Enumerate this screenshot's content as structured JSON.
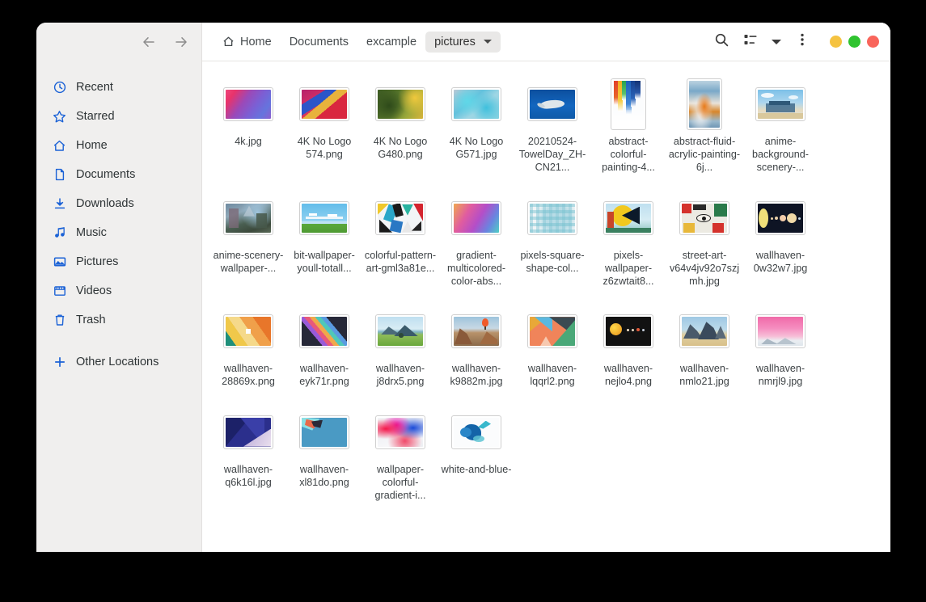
{
  "window": {
    "background_color": "#000000",
    "body_color": "#ffffff",
    "sidebar_color": "#f0efee"
  },
  "sidebar": {
    "nav": {
      "back_label": "Back",
      "back_icon": "arrow-left-icon",
      "forward_label": "Forward",
      "forward_icon": "arrow-right-icon"
    },
    "items": [
      {
        "label": "Recent",
        "icon": "clock-icon"
      },
      {
        "label": "Starred",
        "icon": "star-icon"
      },
      {
        "label": "Home",
        "icon": "home-icon"
      },
      {
        "label": "Documents",
        "icon": "document-icon"
      },
      {
        "label": "Downloads",
        "icon": "download-icon"
      },
      {
        "label": "Music",
        "icon": "music-note-icon"
      },
      {
        "label": "Pictures",
        "icon": "picture-icon"
      },
      {
        "label": "Videos",
        "icon": "video-icon"
      },
      {
        "label": "Trash",
        "icon": "trash-icon"
      },
      {
        "label": "Other Locations",
        "icon": "plus-icon"
      }
    ],
    "accent_color": "#1b62d6"
  },
  "toolbar": {
    "breadcrumb": [
      {
        "label": "Home",
        "icon": "home-icon",
        "current": false
      },
      {
        "label": "Documents",
        "icon": "",
        "current": false
      },
      {
        "label": "excample",
        "icon": "",
        "current": false
      },
      {
        "label": "pictures",
        "icon": "",
        "current": true
      }
    ],
    "search_icon": "search-icon",
    "view_toggle_icon": "list-view-icon",
    "view_caret_icon": "chevron-down-icon",
    "menu_icon": "three-dot-menu-icon",
    "window_controls": [
      {
        "name": "minimize",
        "color": "#f5c341"
      },
      {
        "name": "maximize",
        "color": "#2fc32f"
      },
      {
        "name": "close",
        "color": "#f9655b"
      }
    ]
  },
  "files": [
    {
      "name": "4k.jpg",
      "orientation": "landscape",
      "thumb": "t-4k"
    },
    {
      "name": "4K No Logo 574.png",
      "orientation": "landscape",
      "thumb": "t-574"
    },
    {
      "name": "4K No Logo G480.png",
      "orientation": "landscape",
      "thumb": "t-g480"
    },
    {
      "name": "4K No Logo G571.jpg",
      "orientation": "landscape",
      "thumb": "t-g571"
    },
    {
      "name": "20210524-TowelDay_ZH-CN21...",
      "orientation": "landscape",
      "thumb": "t-towelday"
    },
    {
      "name": "abstract-colorful-painting-4...",
      "orientation": "portrait",
      "thumb": "t-abstract-colorful"
    },
    {
      "name": "abstract-fluid-acrylic-painting-6j...",
      "orientation": "portrait",
      "thumb": "t-abstract-fluid"
    },
    {
      "name": "anime-background-scenery-...",
      "orientation": "landscape",
      "thumb": "t-anime-bg"
    },
    {
      "name": "anime-scenery-wallpaper-...",
      "orientation": "landscape",
      "thumb": "t-anime-scenery"
    },
    {
      "name": "bit-wallpaper-youll-totall...",
      "orientation": "landscape",
      "thumb": "t-bit"
    },
    {
      "name": "colorful-pattern-art-gml3a81e...",
      "orientation": "landscape",
      "thumb": "t-colorful-pattern"
    },
    {
      "name": "gradient-multicolored-color-abs...",
      "orientation": "landscape",
      "thumb": "t-gradient-multi"
    },
    {
      "name": "pixels-square-shape-col...",
      "orientation": "landscape",
      "thumb": "t-pixels-square"
    },
    {
      "name": "pixels-wallpaper-z6zwtait8...",
      "orientation": "landscape",
      "thumb": "t-pixels-wall"
    },
    {
      "name": "street-art-v64v4jv92o7szjmh.jpg",
      "orientation": "landscape",
      "thumb": "t-street-art"
    },
    {
      "name": "wallhaven-0w32w7.jpg",
      "orientation": "landscape",
      "thumb": "t-0w32w7"
    },
    {
      "name": "wallhaven-28869x.png",
      "orientation": "landscape",
      "thumb": "t-28869x"
    },
    {
      "name": "wallhaven-eyk71r.png",
      "orientation": "landscape",
      "thumb": "t-eyk71r"
    },
    {
      "name": "wallhaven-j8drx5.png",
      "orientation": "landscape",
      "thumb": "t-j8drx5"
    },
    {
      "name": "wallhaven-k9882m.jpg",
      "orientation": "landscape",
      "thumb": "t-k9882m"
    },
    {
      "name": "wallhaven-lqqrl2.png",
      "orientation": "landscape",
      "thumb": "t-lqqrl2"
    },
    {
      "name": "wallhaven-nejlo4.png",
      "orientation": "landscape",
      "thumb": "t-nejlo4"
    },
    {
      "name": "wallhaven-nmlo21.jpg",
      "orientation": "landscape",
      "thumb": "t-nmlo21"
    },
    {
      "name": "wallhaven-nmrjl9.jpg",
      "orientation": "landscape",
      "thumb": "t-nmrjl9"
    },
    {
      "name": "wallhaven-q6k16l.jpg",
      "orientation": "landscape",
      "thumb": "t-q6k16l"
    },
    {
      "name": "wallhaven-xl81do.png",
      "orientation": "landscape",
      "thumb": "t-xl81do"
    },
    {
      "name": "wallpaper-colorful-gradient-i...",
      "orientation": "landscape",
      "thumb": "t-wall-colorful"
    },
    {
      "name": "white-and-blue-",
      "orientation": "landscape",
      "thumb": "t-white-blue"
    }
  ]
}
